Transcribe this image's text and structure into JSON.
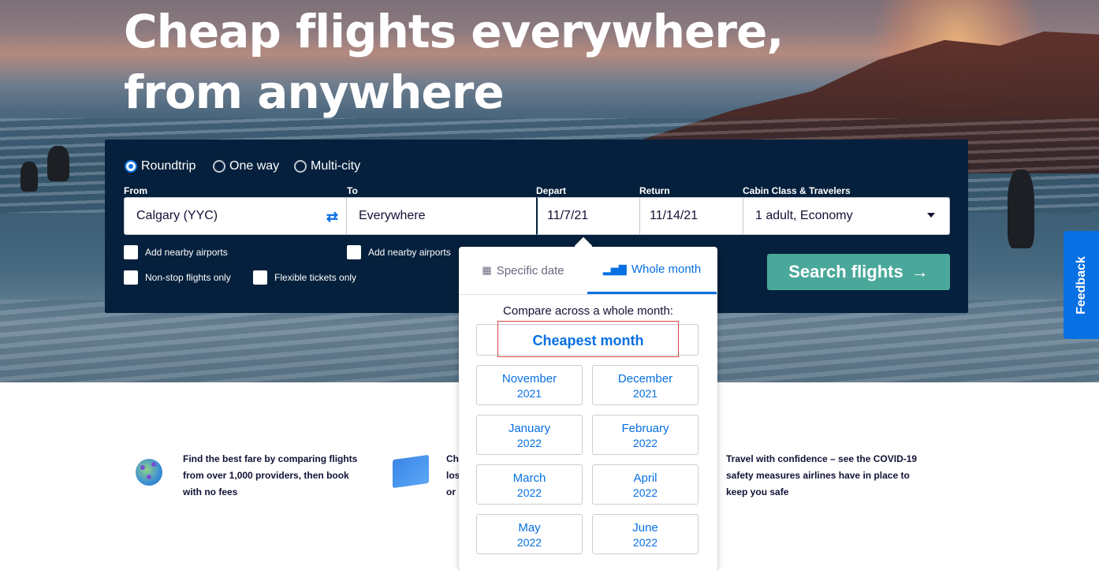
{
  "hero": {
    "title": "Cheap flights everywhere, from anywhere"
  },
  "search_panel": {
    "trip_types": [
      {
        "label": "Roundtrip",
        "selected": true
      },
      {
        "label": "One way",
        "selected": false
      },
      {
        "label": "Multi-city",
        "selected": false
      }
    ],
    "labels": {
      "from": "From",
      "to": "To",
      "depart": "Depart",
      "return": "Return",
      "cabin": "Cabin Class & Travelers"
    },
    "values": {
      "from": "Calgary (YYC)",
      "to": "Everywhere",
      "depart": "11/7/21",
      "return": "11/14/21",
      "cabin": "1 adult, Economy"
    },
    "checkboxes": {
      "nearby_from": "Add nearby airports",
      "nearby_to": "Add nearby airports",
      "nonstop": "Non-stop flights only",
      "flexible": "Flexible tickets only"
    },
    "search_button": "Search flights",
    "icons": {
      "swap": "swap-icon",
      "arrow": "arrow-right-icon",
      "caret": "chevron-down-icon"
    }
  },
  "date_dropdown": {
    "tabs": {
      "specific": "Specific date",
      "whole_month": "Whole month",
      "active": "whole_month"
    },
    "compare_label": "Compare across a whole month:",
    "cheapest": "Cheapest month",
    "months": [
      {
        "month": "November",
        "year": "2021"
      },
      {
        "month": "December",
        "year": "2021"
      },
      {
        "month": "January",
        "year": "2022"
      },
      {
        "month": "February",
        "year": "2022"
      },
      {
        "month": "March",
        "year": "2022"
      },
      {
        "month": "April",
        "year": "2022"
      },
      {
        "month": "May",
        "year": "2022"
      },
      {
        "month": "June",
        "year": "2022"
      }
    ]
  },
  "feedback": "Feedback",
  "features": {
    "f1": [
      "Find the best fare by comparing flights",
      "from over 1,000 providers, then book",
      "with no fees"
    ],
    "f2": [
      "Ch",
      "los",
      "or"
    ],
    "f3": [
      "Travel with confidence – see the COVID-19",
      "safety measures airlines have in place to",
      "keep you safe"
    ]
  },
  "colors": {
    "brand_blue": "#0770e3",
    "panel_navy": "#05203c",
    "search_green": "#4aa89a",
    "highlight_red": "#d64541"
  }
}
